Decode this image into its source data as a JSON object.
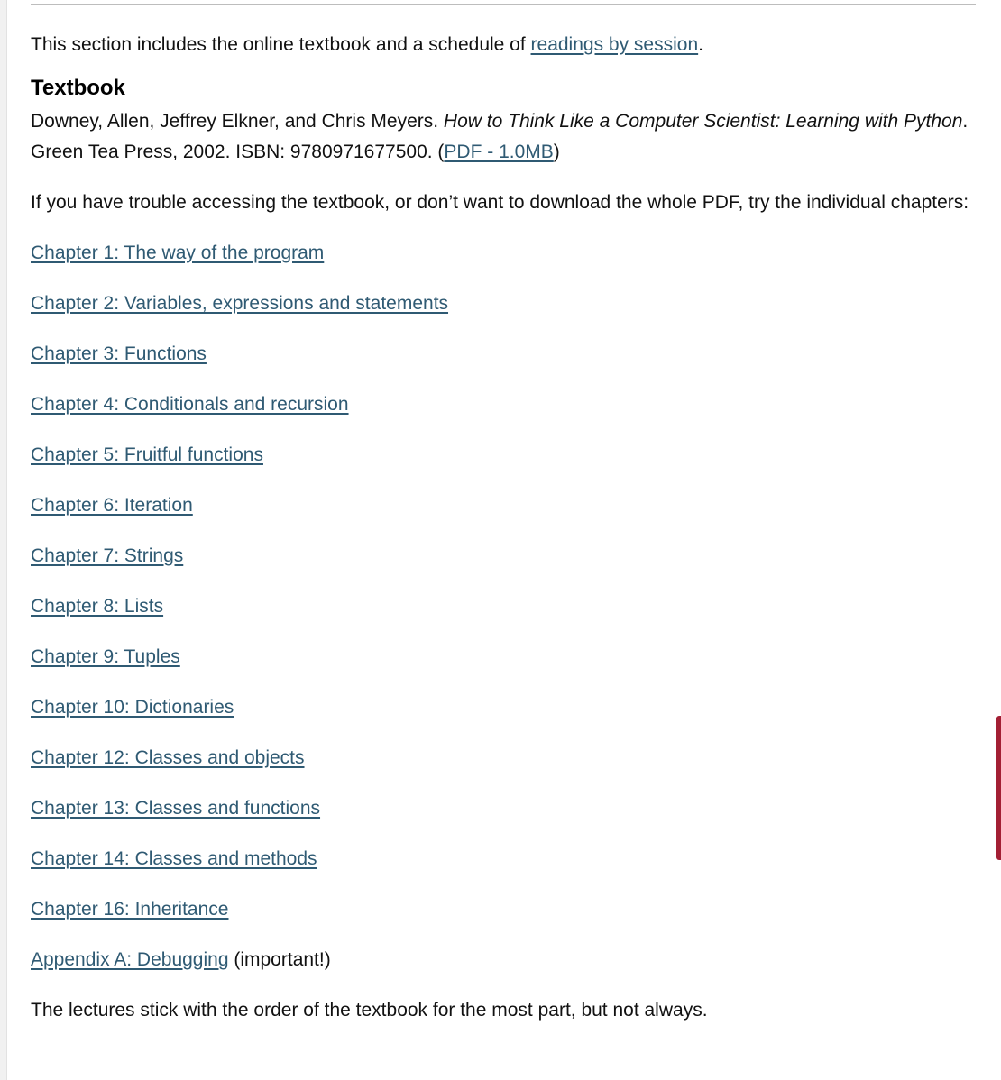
{
  "intro": {
    "text_before_link": "This section includes the online textbook and a schedule of ",
    "link_label": "readings by session",
    "text_after_link": "."
  },
  "textbook": {
    "heading": "Textbook",
    "authors": "Downey, Allen, Jeffrey Elkner, and Chris Meyers. ",
    "title": "How to Think Like a Computer Scientist: Learning with Python",
    "publication": ". Green Tea Press, 2002. ISBN: 9780971677500. (",
    "pdf_link_label": "PDF - 1.0MB",
    "closing_paren": ")"
  },
  "trouble_text": "If you have trouble accessing the textbook, or don’t want to download the whole PDF, try the individual chapters:",
  "chapters": [
    {
      "label": "Chapter 1: The way of the program",
      "suffix": ""
    },
    {
      "label": "Chapter 2: Variables, expressions and statements",
      "suffix": ""
    },
    {
      "label": "Chapter 3: Functions",
      "suffix": ""
    },
    {
      "label": "Chapter 4: Conditionals and recursion",
      "suffix": ""
    },
    {
      "label": "Chapter 5: Fruitful functions",
      "suffix": ""
    },
    {
      "label": "Chapter 6: Iteration",
      "suffix": ""
    },
    {
      "label": "Chapter 7: Strings",
      "suffix": ""
    },
    {
      "label": "Chapter 8: Lists",
      "suffix": ""
    },
    {
      "label": "Chapter 9: Tuples",
      "suffix": ""
    },
    {
      "label": "Chapter 10: Dictionaries",
      "suffix": ""
    },
    {
      "label": "Chapter 12: Classes and objects",
      "suffix": ""
    },
    {
      "label": "Chapter 13: Classes and functions",
      "suffix": ""
    },
    {
      "label": "Chapter 14: Classes and methods",
      "suffix": ""
    },
    {
      "label": "Chapter 16: Inheritance",
      "suffix": ""
    },
    {
      "label": "Appendix A: Debugging",
      "suffix": " (important!)"
    }
  ],
  "closing_text": "The lectures stick with the order of the textbook for the most part, but not always.",
  "colors": {
    "link": "#2f5a73",
    "text": "#111111",
    "accent_tab": "#a31f34"
  }
}
